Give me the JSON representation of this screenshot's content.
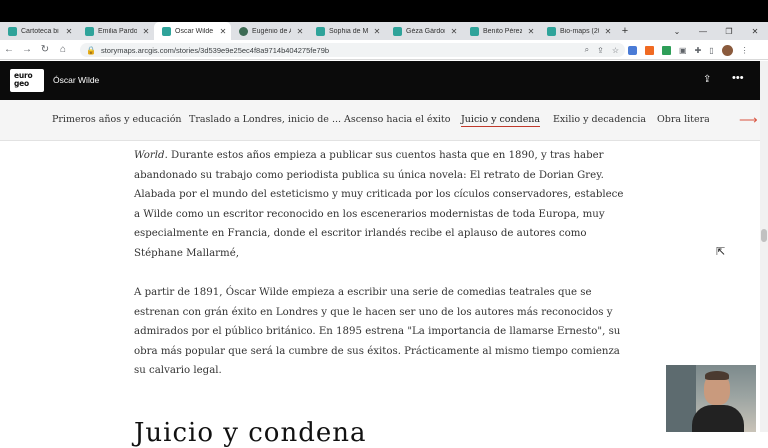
{
  "browser": {
    "tabs": [
      {
        "title": "Cartoteca bi",
        "icon": "storymaps-icon",
        "active": false
      },
      {
        "title": "Emilia Pardo",
        "icon": "storymaps-icon",
        "active": false
      },
      {
        "title": "Óscar Wilde",
        "icon": "storymaps-icon",
        "active": true
      },
      {
        "title": "Eugénio de A",
        "icon": "dark-globe-icon",
        "active": false
      },
      {
        "title": "Sophia de M",
        "icon": "storymaps-icon",
        "active": false
      },
      {
        "title": "Géza Gárdon",
        "icon": "storymaps-icon",
        "active": false
      },
      {
        "title": "Benito Pérez",
        "icon": "storymaps-icon",
        "active": false
      },
      {
        "title": "Bio-maps (20",
        "icon": "storymaps-icon",
        "active": false
      }
    ],
    "new_tab": "+",
    "url": "storymaps.arcgis.com/stories/3d539e9e25ec4f8a9714b404275fe79b"
  },
  "story": {
    "logo_line1": "euro",
    "logo_line2": "geo",
    "title": "Óscar Wilde",
    "nav": [
      {
        "label": "Primeros años y educación",
        "active": false
      },
      {
        "label": "Traslado a Londres, inicio de ...",
        "active": false
      },
      {
        "label": "Ascenso hacia el éxito",
        "active": false
      },
      {
        "label": "Juicio y condena",
        "active": true
      },
      {
        "label": "Exilio y decadencia",
        "active": false
      },
      {
        "label": "Obra literar",
        "active": false
      }
    ],
    "paragraph1": [
      {
        "text": "World",
        "italic": true
      },
      {
        "text": ". Durante estos años empieza a publicar sus cuentos hasta que en 1890, y tras haber abandonado su trabajo como periodista publica su única novela: El retrato de Dorian Grey. Alabada por el mundo del esteticismo y muy criticada por los cículos conservadores, establece a Wilde como un escritor reconocido en los escenerarios modernistas de toda Europa, muy especialmente en Francia, donde el escritor irlandés recibe el aplauso de autores como Stéphane Mallarmé,",
        "italic": false
      }
    ],
    "paragraph2": "A partir de 1891, Óscar Wilde empieza a escribir una serie de comedias teatrales que  se estrenan con grán éxito en Londres y que le hacen ser uno de los autores más reconocidos y admirados por el público británico. En 1895 estrena \"La importancia de llamarse Ernesto\", su obra más popular que será la cumbre de sus éxitos. Prácticamente al mismo tiempo comienza su calvario legal.",
    "next_heading_partial": "Juicio y condena"
  }
}
